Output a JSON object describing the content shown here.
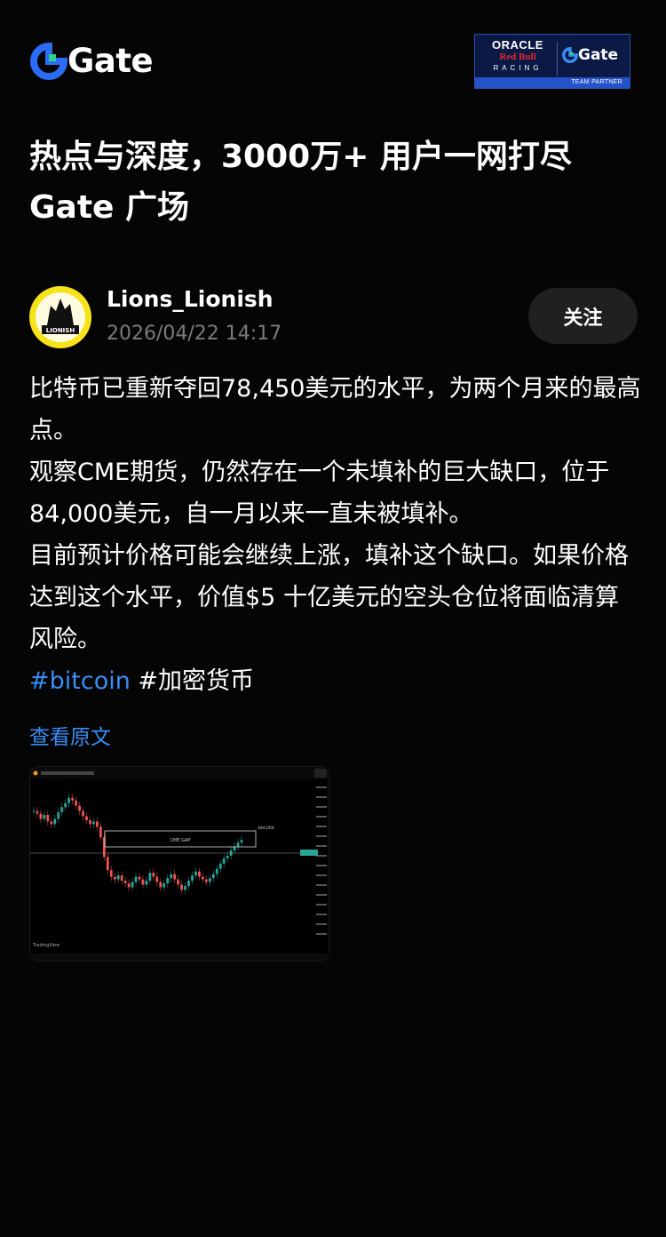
{
  "header": {
    "logo_text": "Gate",
    "partner": {
      "oracle": "ORACLE",
      "redbull": "Red Bull",
      "racing": "RACING",
      "gate": "Gate",
      "team_partner": "TEAM PARTNER"
    }
  },
  "headline": {
    "line1": "热点与深度，3000万+ 用户一网打尽",
    "line2": "Gate 广场"
  },
  "author": {
    "avatar_text": "LIONISH",
    "name": "Lions_Lionish",
    "timestamp": "2026/04/22 14:17",
    "follow_label": "关注"
  },
  "post": {
    "paragraphs": [
      "比特币已重新夺回78,450美元的水平，为两个月来的最高点。",
      "观察CME期货，仍然存在一个未填补的巨大缺口，位于84,000美元，自一月以来一直未被填补。",
      "目前预计价格可能会继续上涨，填补这个缺口。如果价格达到这个水平，价值$5 十亿美元的空头仓位将面临清算风险。"
    ],
    "tags": [
      "#bitcoin",
      "#加密货币"
    ]
  },
  "view_original_label": "查看原文",
  "chart_image": {
    "gap_label": "CME GAP",
    "gap_price": "$84,000",
    "watermark": "TradingView"
  },
  "colors": {
    "background": "#050505",
    "link": "#3a8cf5",
    "muted": "#7a7a7a",
    "follow_bg": "#202020",
    "candle_up": "#26a69a",
    "candle_down": "#ef5350"
  }
}
